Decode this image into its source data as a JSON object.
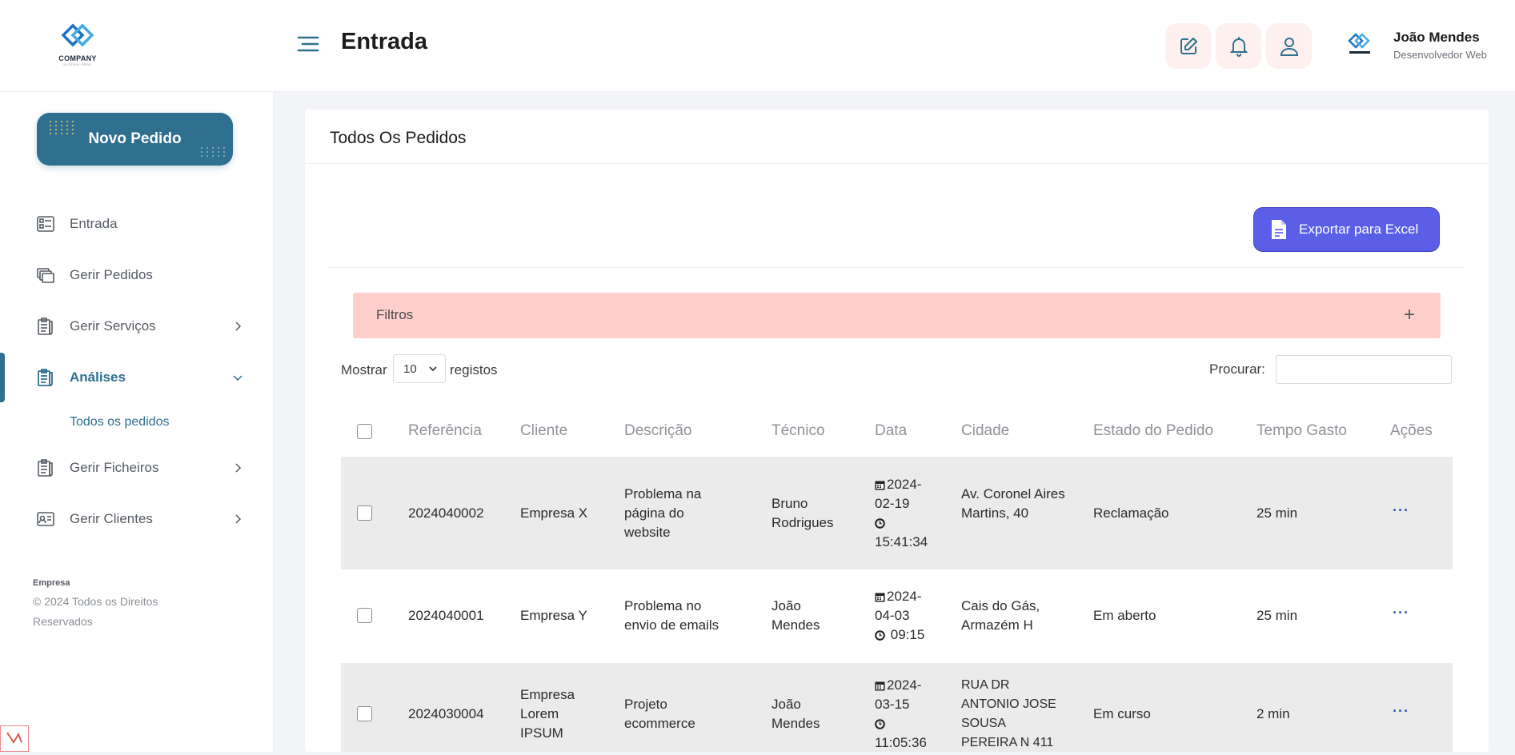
{
  "header": {
    "logo_text": "COMPANY",
    "logo_sub": "SLOGAN HERE",
    "page_title": "Entrada",
    "user": {
      "name": "João Mendes",
      "role": "Desenvolvedor Web"
    }
  },
  "sidebar": {
    "new_order": "Novo Pedido",
    "items": [
      {
        "label": "Entrada",
        "icon": "inbox-icon",
        "has_chevron": false
      },
      {
        "label": "Gerir Pedidos",
        "icon": "orders-icon",
        "has_chevron": false
      },
      {
        "label": "Gerir Serviços",
        "icon": "clipboard-icon",
        "has_chevron": true
      },
      {
        "label": "Análises",
        "icon": "clipboard-icon",
        "has_chevron": true,
        "active": true
      },
      {
        "label": "Gerir Ficheiros",
        "icon": "clipboard-icon",
        "has_chevron": true
      },
      {
        "label": "Gerir Clientes",
        "icon": "id-card-icon",
        "has_chevron": true
      }
    ],
    "sub_item": "Todos os pedidos",
    "footer_company": "Empresa",
    "footer_copy": "© 2024 Todos os Direitos Reservados"
  },
  "main": {
    "card_title": "Todos Os Pedidos",
    "export_label": "Exportar para Excel",
    "filters_label": "Filtros",
    "filters_toggle": "+",
    "show_label": "Mostrar",
    "show_value": "10",
    "records_label": "registos",
    "search_label": "Procurar:",
    "search_value": "",
    "columns": [
      "Referência",
      "Cliente",
      "Descrição",
      "Técnico",
      "Data",
      "Cidade",
      "Estado do Pedido",
      "Tempo Gasto",
      "Ações"
    ],
    "rows": [
      {
        "ref": "2024040002",
        "client": "Empresa X",
        "description": "Problema na página do website",
        "technician": "Bruno Rodrigues",
        "date": "2024-02-19",
        "time": "15:41:34",
        "city": "Av. Coronel Aires Martins, 40",
        "status": "Reclamação",
        "time_spent": "25 min",
        "actions": "···"
      },
      {
        "ref": "2024040001",
        "client": "Empresa Y",
        "description": "Problema no envio de emails",
        "technician": "João Mendes",
        "date": "2024-04-03",
        "time": "09:15",
        "city": "Cais do Gás, Armazém H",
        "status": "Em aberto",
        "time_spent": "25 min",
        "actions": "···"
      },
      {
        "ref": "2024030004",
        "client": "Empresa Lorem IPSUM",
        "description": "Projeto ecommerce",
        "technician": "João Mendes",
        "date": "2024-03-15",
        "time": "11:05:36",
        "city": "RUA DR ANTONIO JOSE SOUSA PEREIRA N 411",
        "status": "Em curso",
        "time_spent": "2 min",
        "actions": "···"
      }
    ]
  },
  "colors": {
    "primary": "#2f6f8f",
    "export": "#5b5fe8",
    "filters_bg": "#fecfcb",
    "icon_bg": "#fdf0ef"
  }
}
